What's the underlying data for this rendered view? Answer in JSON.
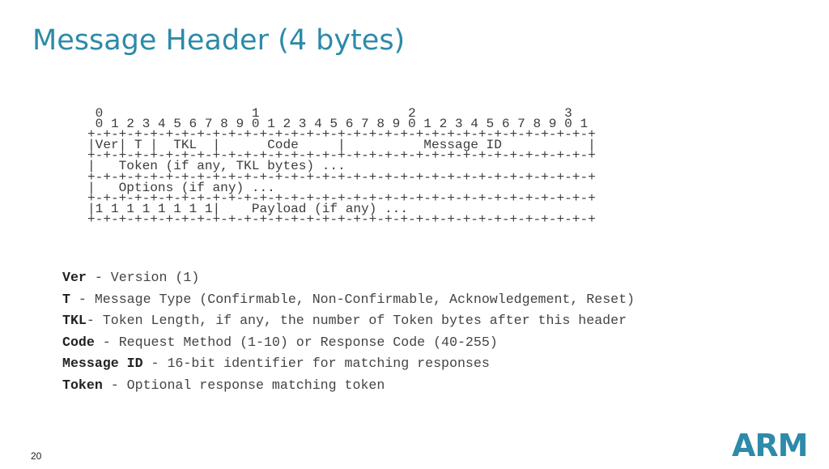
{
  "slide": {
    "title": "Message Header (4 bytes)",
    "page_number": "20",
    "logo_text": "ARM"
  },
  "diagram_lines": [
    " 0                   1                   2                   3",
    " 0 1 2 3 4 5 6 7 8 9 0 1 2 3 4 5 6 7 8 9 0 1 2 3 4 5 6 7 8 9 0 1",
    "+-+-+-+-+-+-+-+-+-+-+-+-+-+-+-+-+-+-+-+-+-+-+-+-+-+-+-+-+-+-+-+-+",
    "|Ver| T |  TKL  |      Code     |          Message ID           |",
    "+-+-+-+-+-+-+-+-+-+-+-+-+-+-+-+-+-+-+-+-+-+-+-+-+-+-+-+-+-+-+-+-+",
    "|   Token (if any, TKL bytes) ...",
    "+-+-+-+-+-+-+-+-+-+-+-+-+-+-+-+-+-+-+-+-+-+-+-+-+-+-+-+-+-+-+-+-+",
    "|   Options (if any) ...",
    "+-+-+-+-+-+-+-+-+-+-+-+-+-+-+-+-+-+-+-+-+-+-+-+-+-+-+-+-+-+-+-+-+",
    "|1 1 1 1 1 1 1 1|    Payload (if any) ...",
    "+-+-+-+-+-+-+-+-+-+-+-+-+-+-+-+-+-+-+-+-+-+-+-+-+-+-+-+-+-+-+-+-+"
  ],
  "definitions": [
    {
      "term": "Ver",
      "desc": " - Version (1)"
    },
    {
      "term": "T",
      "desc": " - Message Type (Confirmable, Non-Confirmable, Acknowledgement, Reset)"
    },
    {
      "term": "TKL",
      "desc": "- Token Length, if any, the number of Token bytes after this header"
    },
    {
      "term": "Code",
      "desc": " - Request Method (1-10) or Response Code (40-255)"
    },
    {
      "term": "Message ID",
      "desc": " - 16-bit identifier for matching responses"
    },
    {
      "term": "Token",
      "desc": " - Optional response matching token"
    }
  ],
  "colors": {
    "title": "#2d8aa8",
    "logo": "#2e8aa9"
  }
}
